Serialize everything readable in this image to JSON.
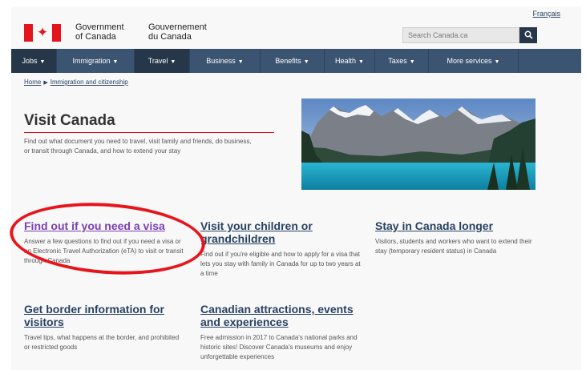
{
  "header": {
    "language_link": "Français",
    "gov_en_line1": "Government",
    "gov_en_line2": "of Canada",
    "gov_fr_line1": "Gouvernement",
    "gov_fr_line2": "du Canada",
    "search_placeholder": "Search Canada.ca",
    "search_icon": "magnifier-icon"
  },
  "nav": {
    "items": [
      {
        "label": "Jobs"
      },
      {
        "label": "Immigration"
      },
      {
        "label": "Travel"
      },
      {
        "label": "Business"
      },
      {
        "label": "Benefits"
      },
      {
        "label": "Health"
      },
      {
        "label": "Taxes"
      },
      {
        "label": "More services"
      }
    ],
    "caret": "▼"
  },
  "breadcrumb": {
    "home": "Home",
    "current": "Immigration and citizenship"
  },
  "main": {
    "title": "Visit Canada",
    "intro": "Find out what document you need to travel, visit family and friends, do business, or transit through Canada, and how to extend your stay"
  },
  "cards": [
    {
      "title": "Find out if you need a visa",
      "desc": "Answer a few questions to find out if you need a visa or an Electronic Travel Authorization (eTA) to visit or transit through Canada"
    },
    {
      "title": "Visit your children or grandchildren",
      "desc": "Find out if you're eligible and how to apply for a visa that lets you stay with family in Canada for up to two years at a time"
    },
    {
      "title": "Stay in Canada longer",
      "desc": "Visitors, students and workers who want to extend their stay (temporary resident status) in Canada"
    },
    {
      "title": "Get border information for visitors",
      "desc": "Travel tips, what happens at the border, and prohibited or restricted goods"
    },
    {
      "title": "Canadian attractions, events and experiences",
      "desc": "Free admission in 2017 to Canada's national parks and historic sites! Discover Canada's museums and enjoy unforgettable experiences"
    }
  ],
  "colors": {
    "nav_bg": "#3b5472",
    "link": "#284162",
    "flag_red": "#e3141c",
    "highlight": "#e8141c"
  }
}
